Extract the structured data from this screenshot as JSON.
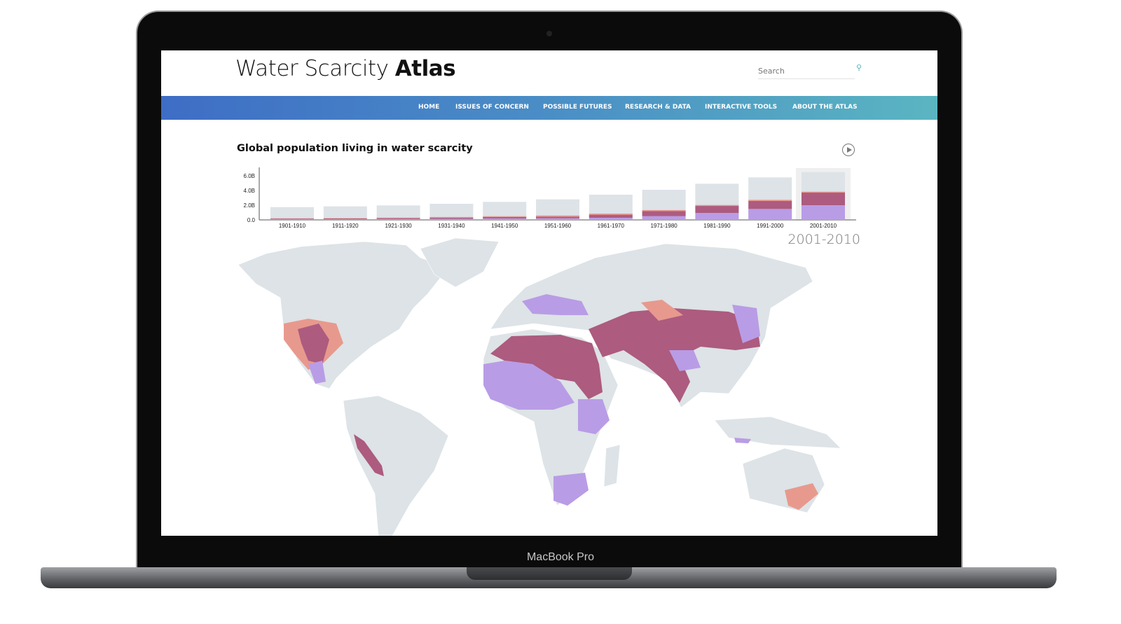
{
  "device": {
    "label": "MacBook Pro"
  },
  "header": {
    "title_light": "Water Scarcity ",
    "title_bold": "Atlas",
    "search_placeholder": "Search",
    "search_icon": "search-icon"
  },
  "nav": {
    "items": [
      {
        "label": "HOME"
      },
      {
        "label": "ISSUES OF CONCERN"
      },
      {
        "label": "POSSIBLE FUTURES"
      },
      {
        "label": "RESEARCH & DATA"
      },
      {
        "label": "INTERACTIVE TOOLS"
      },
      {
        "label": "ABOUT THE ATLAS"
      }
    ]
  },
  "colors": {
    "nav_start": "#3e6dc5",
    "nav_end": "#5ab5c1",
    "total": "#dde3e7",
    "purple": "#b99ce6",
    "darkred": "#ad5b7f",
    "salmon": "#e8998d",
    "land": "#dde3e6"
  },
  "chart": {
    "title": "Global population living in water scarcity",
    "play_icon": "play-circle-icon",
    "selected_period": "2001-2010"
  },
  "chart_data": {
    "type": "bar",
    "stacked": true,
    "ylim": [
      0,
      6.0
    ],
    "yticks": [
      "0.0",
      "2.0B",
      "4.0B",
      "6.0B"
    ],
    "ytick_values": [
      0,
      2,
      4,
      6
    ],
    "categories": [
      "1901-1910",
      "1911-1920",
      "1921-1930",
      "1931-1940",
      "1941-1950",
      "1951-1960",
      "1961-1970",
      "1971-1980",
      "1981-1990",
      "1991-2000",
      "2001-2010"
    ],
    "total": [
      1.74,
      1.84,
      1.97,
      2.19,
      2.45,
      2.79,
      3.43,
      4.1,
      4.92,
      5.78,
      6.5
    ],
    "series": [
      {
        "color": "#b99ce6",
        "values": [
          0.1,
          0.1,
          0.12,
          0.15,
          0.2,
          0.22,
          0.29,
          0.51,
          0.95,
          1.49,
          2.0
        ]
      },
      {
        "color": "#ad5b7f",
        "values": [
          0.08,
          0.1,
          0.12,
          0.15,
          0.2,
          0.22,
          0.41,
          0.7,
          0.95,
          1.08,
          1.71
        ]
      },
      {
        "color": "#e8998d",
        "values": [
          0.04,
          0.05,
          0.06,
          0.1,
          0.1,
          0.16,
          0.16,
          0.13,
          0.13,
          0.16,
          0.13
        ]
      }
    ],
    "grid": false,
    "highlighted_category": "2001-2010"
  }
}
